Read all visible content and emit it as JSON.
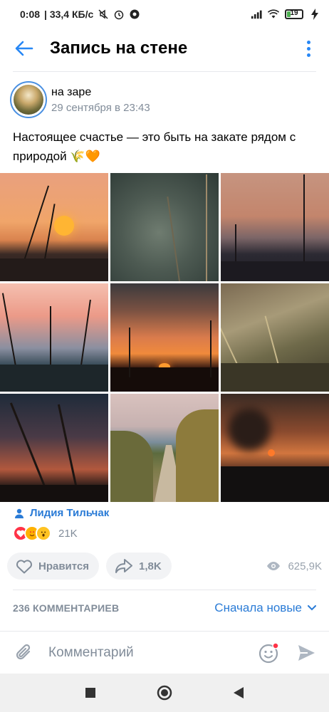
{
  "status_bar": {
    "time": "0:08",
    "speed": "| 33,4 КБ/с",
    "battery": "19",
    "icons": [
      "mute-icon",
      "alarm-icon",
      "chat-icon",
      "signal-icon",
      "wifi-icon",
      "battery-icon",
      "charging-icon"
    ]
  },
  "header": {
    "title": "Запись на стене",
    "back_icon": "back-arrow-icon",
    "more_icon": "more-vertical-icon"
  },
  "post": {
    "author_name": "на заре",
    "date": "29 сентября в 23:43",
    "text_line1": "Настоящее счастье — это быть на закате рядом с",
    "text_line2": "природой",
    "text_emoji": "🌾🧡",
    "photos": [
      {
        "scene": "sunset-grass-sun"
      },
      {
        "scene": "spider-web"
      },
      {
        "scene": "plant-silhouette-dusk"
      },
      {
        "scene": "flowers-pink-sky"
      },
      {
        "scene": "orange-sunset-horizon"
      },
      {
        "scene": "golden-grass"
      },
      {
        "scene": "branches-dark-sky"
      },
      {
        "scene": "road-to-sea"
      },
      {
        "scene": "sunset-field-blur"
      }
    ]
  },
  "reactions": {
    "liked_by": "Лидия Тильчак",
    "count": "21K",
    "emojis": [
      "heart",
      "heart-eyes",
      "wow"
    ]
  },
  "actions": {
    "like_label": "Нравится",
    "share_count": "1,8K",
    "views_count": "625,9K"
  },
  "comments": {
    "count_label": "236 КОММЕНТАРИЕВ",
    "sort_label": "Сначала новые"
  },
  "compose": {
    "placeholder": "Комментарий"
  },
  "colors": {
    "accent": "#2787f5",
    "link": "#2a7bd6",
    "secondary_text": "#818c99",
    "pill_bg": "#f2f3f5"
  }
}
